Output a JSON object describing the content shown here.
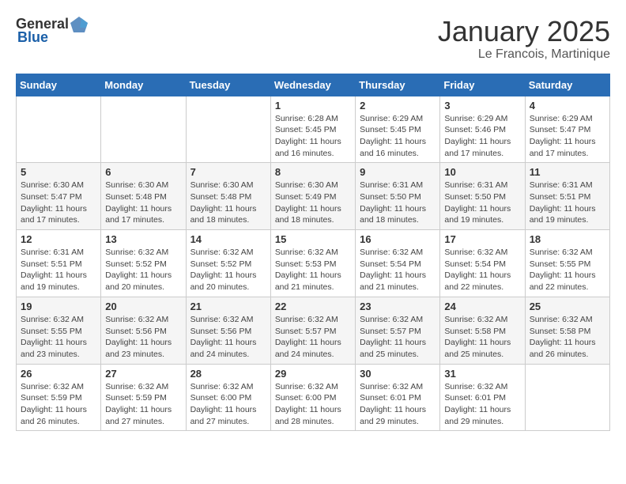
{
  "logo": {
    "general": "General",
    "blue": "Blue"
  },
  "title": "January 2025",
  "subtitle": "Le Francois, Martinique",
  "days_of_week": [
    "Sunday",
    "Monday",
    "Tuesday",
    "Wednesday",
    "Thursday",
    "Friday",
    "Saturday"
  ],
  "weeks": [
    [
      {
        "day": "",
        "info": ""
      },
      {
        "day": "",
        "info": ""
      },
      {
        "day": "",
        "info": ""
      },
      {
        "day": "1",
        "info": "Sunrise: 6:28 AM\nSunset: 5:45 PM\nDaylight: 11 hours and 16 minutes."
      },
      {
        "day": "2",
        "info": "Sunrise: 6:29 AM\nSunset: 5:45 PM\nDaylight: 11 hours and 16 minutes."
      },
      {
        "day": "3",
        "info": "Sunrise: 6:29 AM\nSunset: 5:46 PM\nDaylight: 11 hours and 17 minutes."
      },
      {
        "day": "4",
        "info": "Sunrise: 6:29 AM\nSunset: 5:47 PM\nDaylight: 11 hours and 17 minutes."
      }
    ],
    [
      {
        "day": "5",
        "info": "Sunrise: 6:30 AM\nSunset: 5:47 PM\nDaylight: 11 hours and 17 minutes."
      },
      {
        "day": "6",
        "info": "Sunrise: 6:30 AM\nSunset: 5:48 PM\nDaylight: 11 hours and 17 minutes."
      },
      {
        "day": "7",
        "info": "Sunrise: 6:30 AM\nSunset: 5:48 PM\nDaylight: 11 hours and 18 minutes."
      },
      {
        "day": "8",
        "info": "Sunrise: 6:30 AM\nSunset: 5:49 PM\nDaylight: 11 hours and 18 minutes."
      },
      {
        "day": "9",
        "info": "Sunrise: 6:31 AM\nSunset: 5:50 PM\nDaylight: 11 hours and 18 minutes."
      },
      {
        "day": "10",
        "info": "Sunrise: 6:31 AM\nSunset: 5:50 PM\nDaylight: 11 hours and 19 minutes."
      },
      {
        "day": "11",
        "info": "Sunrise: 6:31 AM\nSunset: 5:51 PM\nDaylight: 11 hours and 19 minutes."
      }
    ],
    [
      {
        "day": "12",
        "info": "Sunrise: 6:31 AM\nSunset: 5:51 PM\nDaylight: 11 hours and 19 minutes."
      },
      {
        "day": "13",
        "info": "Sunrise: 6:32 AM\nSunset: 5:52 PM\nDaylight: 11 hours and 20 minutes."
      },
      {
        "day": "14",
        "info": "Sunrise: 6:32 AM\nSunset: 5:52 PM\nDaylight: 11 hours and 20 minutes."
      },
      {
        "day": "15",
        "info": "Sunrise: 6:32 AM\nSunset: 5:53 PM\nDaylight: 11 hours and 21 minutes."
      },
      {
        "day": "16",
        "info": "Sunrise: 6:32 AM\nSunset: 5:54 PM\nDaylight: 11 hours and 21 minutes."
      },
      {
        "day": "17",
        "info": "Sunrise: 6:32 AM\nSunset: 5:54 PM\nDaylight: 11 hours and 22 minutes."
      },
      {
        "day": "18",
        "info": "Sunrise: 6:32 AM\nSunset: 5:55 PM\nDaylight: 11 hours and 22 minutes."
      }
    ],
    [
      {
        "day": "19",
        "info": "Sunrise: 6:32 AM\nSunset: 5:55 PM\nDaylight: 11 hours and 23 minutes."
      },
      {
        "day": "20",
        "info": "Sunrise: 6:32 AM\nSunset: 5:56 PM\nDaylight: 11 hours and 23 minutes."
      },
      {
        "day": "21",
        "info": "Sunrise: 6:32 AM\nSunset: 5:56 PM\nDaylight: 11 hours and 24 minutes."
      },
      {
        "day": "22",
        "info": "Sunrise: 6:32 AM\nSunset: 5:57 PM\nDaylight: 11 hours and 24 minutes."
      },
      {
        "day": "23",
        "info": "Sunrise: 6:32 AM\nSunset: 5:57 PM\nDaylight: 11 hours and 25 minutes."
      },
      {
        "day": "24",
        "info": "Sunrise: 6:32 AM\nSunset: 5:58 PM\nDaylight: 11 hours and 25 minutes."
      },
      {
        "day": "25",
        "info": "Sunrise: 6:32 AM\nSunset: 5:58 PM\nDaylight: 11 hours and 26 minutes."
      }
    ],
    [
      {
        "day": "26",
        "info": "Sunrise: 6:32 AM\nSunset: 5:59 PM\nDaylight: 11 hours and 26 minutes."
      },
      {
        "day": "27",
        "info": "Sunrise: 6:32 AM\nSunset: 5:59 PM\nDaylight: 11 hours and 27 minutes."
      },
      {
        "day": "28",
        "info": "Sunrise: 6:32 AM\nSunset: 6:00 PM\nDaylight: 11 hours and 27 minutes."
      },
      {
        "day": "29",
        "info": "Sunrise: 6:32 AM\nSunset: 6:00 PM\nDaylight: 11 hours and 28 minutes."
      },
      {
        "day": "30",
        "info": "Sunrise: 6:32 AM\nSunset: 6:01 PM\nDaylight: 11 hours and 29 minutes."
      },
      {
        "day": "31",
        "info": "Sunrise: 6:32 AM\nSunset: 6:01 PM\nDaylight: 11 hours and 29 minutes."
      },
      {
        "day": "",
        "info": ""
      }
    ]
  ]
}
